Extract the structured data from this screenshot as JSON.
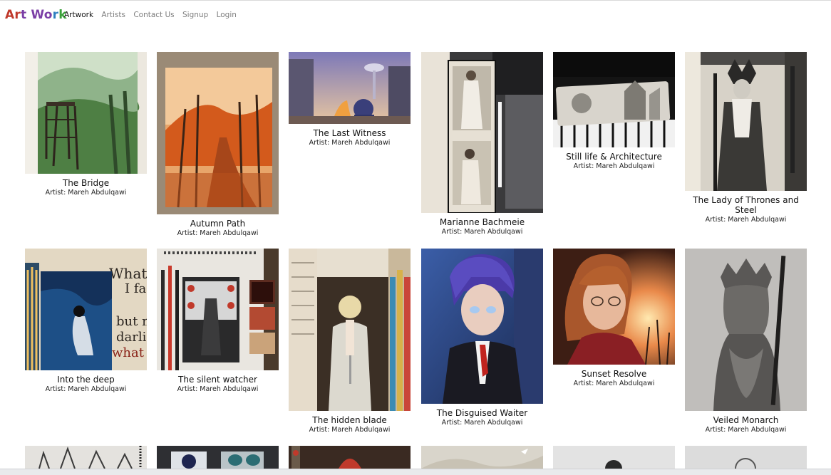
{
  "brand": {
    "letters": [
      {
        "ch": "A",
        "color": "#c0392b"
      },
      {
        "ch": "r",
        "color": "#c0392b"
      },
      {
        "ch": "t",
        "color": "#7b3ea6"
      },
      {
        "ch": " ",
        "color": "#7b3ea6"
      },
      {
        "ch": "W",
        "color": "#7b3ea6"
      },
      {
        "ch": "o",
        "color": "#7b3ea6"
      },
      {
        "ch": "r",
        "color": "#2f7fbf"
      },
      {
        "ch": "k",
        "color": "#3aa13a"
      }
    ]
  },
  "nav": {
    "artwork": "Artwork",
    "artists": "Artists",
    "contact": "Contact Us",
    "signup": "Signup",
    "login": "Login"
  },
  "artworks": [
    {
      "title": "The Bridge",
      "artist": "Artist: Mareh Abdulqawi"
    },
    {
      "title": "Autumn Path",
      "artist": "Artist: Mareh Abdulqawi"
    },
    {
      "title": "The Last Witness",
      "artist": "Artist: Mareh Abdulqawi"
    },
    {
      "title": "Marianne Bachmeie",
      "artist": "Artist: Mareh Abdulqawi"
    },
    {
      "title": "Still life & Architecture",
      "artist": "Artist: Mareh Abdulqawi"
    },
    {
      "title": "The Lady of Thrones and Steel",
      "artist": "Artist: Mareh Abdulqawi"
    },
    {
      "title": "Into the deep",
      "artist": "Artist: Mareh Abdulqawi"
    },
    {
      "title": "The silent watcher",
      "artist": "Artist: Mareh Abdulqawi"
    },
    {
      "title": "The hidden blade",
      "artist": "Artist: Mareh Abdulqawi"
    },
    {
      "title": "The Disguised Waiter",
      "artist": "Artist: Mareh Abdulqawi"
    },
    {
      "title": "Sunset Resolve",
      "artist": "Artist: Mareh Abdulqawi"
    },
    {
      "title": "Veiled Monarch",
      "artist": "Artist: Mareh Abdulqawi"
    }
  ]
}
